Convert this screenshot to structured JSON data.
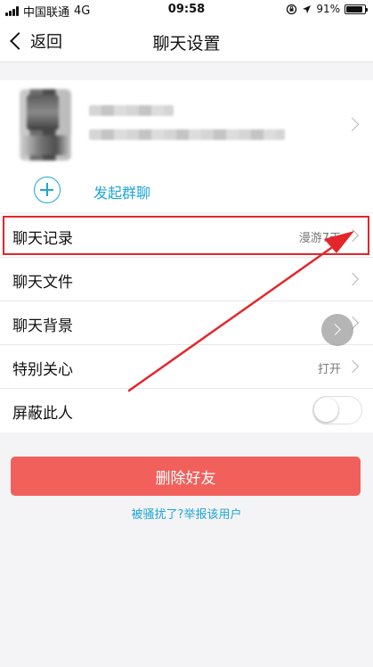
{
  "status_bar": {
    "carrier": "中国联通",
    "network": "4G",
    "time": "09:58",
    "battery": "91%",
    "battery_level": 0.91
  },
  "nav": {
    "back_label": "返回",
    "title": "聊天设置"
  },
  "group_chat": {
    "label": "发起群聊"
  },
  "settings": {
    "items": [
      {
        "label": "聊天记录",
        "value": "漫游7天"
      },
      {
        "label": "聊天文件",
        "value": ""
      },
      {
        "label": "聊天背景",
        "value": ""
      },
      {
        "label": "特别关心",
        "value": "打开"
      },
      {
        "label": "屏蔽此人",
        "value": ""
      }
    ],
    "block_toggle_on": false
  },
  "actions": {
    "delete_label": "删除好友",
    "report_label": "被骚扰了?举报该用户"
  },
  "colors": {
    "accent": "#1ea6d6",
    "danger": "#f2605b",
    "annotation": "#e3262b",
    "background": "#f4f4f6"
  }
}
